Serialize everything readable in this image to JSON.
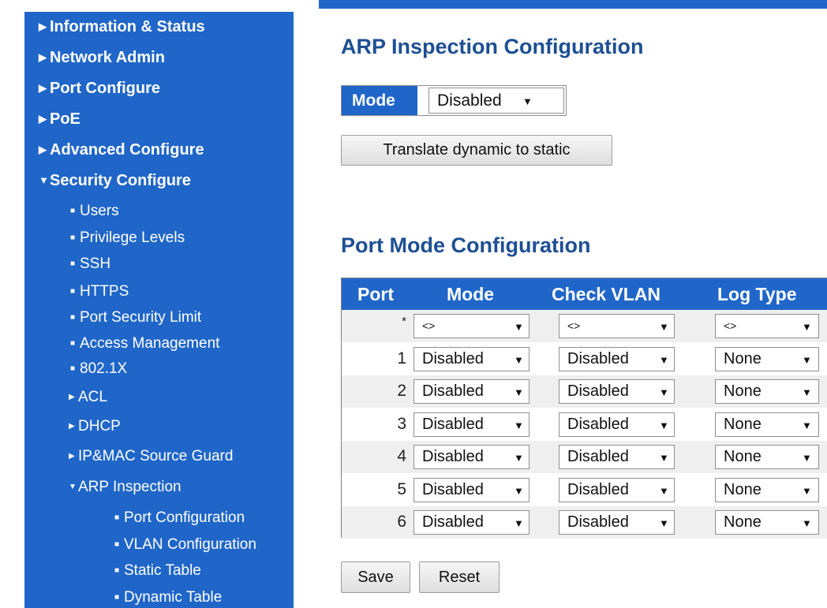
{
  "sidebar": {
    "top_items": [
      {
        "label": "Information & Status",
        "glyph": "▶"
      },
      {
        "label": "Network Admin",
        "glyph": "▶"
      },
      {
        "label": "Port Configure",
        "glyph": "▶"
      },
      {
        "label": "PoE",
        "glyph": "▶"
      },
      {
        "label": "Advanced Configure",
        "glyph": "▶"
      },
      {
        "label": "Security Configure",
        "glyph": "▼"
      }
    ],
    "security_items": [
      {
        "label": "Users",
        "glyph": "■"
      },
      {
        "label": "Privilege Levels",
        "glyph": "■"
      },
      {
        "label": "SSH",
        "glyph": "■"
      },
      {
        "label": "HTTPS",
        "glyph": "■"
      },
      {
        "label": "Port Security Limit",
        "glyph": "■"
      },
      {
        "label": "Access Management",
        "glyph": "■"
      },
      {
        "label": "802.1X",
        "glyph": "■"
      },
      {
        "label": "ACL",
        "glyph": "▶"
      },
      {
        "label": "DHCP",
        "glyph": "▶"
      },
      {
        "label": "IP&MAC Source Guard",
        "glyph": "▶"
      },
      {
        "label": "ARP Inspection",
        "glyph": "▼"
      }
    ],
    "arp_items": [
      {
        "label": "Port Configuration",
        "glyph": "■"
      },
      {
        "label": "VLAN Configuration",
        "glyph": "■"
      },
      {
        "label": "Static Table",
        "glyph": "■"
      },
      {
        "label": "Dynamic Table",
        "glyph": "■"
      }
    ]
  },
  "main": {
    "title": "ARP Inspection Configuration",
    "mode_label": "Mode",
    "mode_value": "Disabled",
    "translate_button": "Translate dynamic to static",
    "port_mode_title": "Port Mode Configuration",
    "table": {
      "headers": [
        "Port",
        "Mode",
        "Check VLAN",
        "Log Type"
      ],
      "wildcard_row": {
        "port": "*",
        "mode": "<>",
        "check_vlan": "<>",
        "log_type": "<>"
      },
      "rows": [
        {
          "port": "1",
          "mode": "Disabled",
          "check_vlan": "Disabled",
          "log_type": "None"
        },
        {
          "port": "2",
          "mode": "Disabled",
          "check_vlan": "Disabled",
          "log_type": "None"
        },
        {
          "port": "3",
          "mode": "Disabled",
          "check_vlan": "Disabled",
          "log_type": "None"
        },
        {
          "port": "4",
          "mode": "Disabled",
          "check_vlan": "Disabled",
          "log_type": "None"
        },
        {
          "port": "5",
          "mode": "Disabled",
          "check_vlan": "Disabled",
          "log_type": "None"
        },
        {
          "port": "6",
          "mode": "Disabled",
          "check_vlan": "Disabled",
          "log_type": "None"
        }
      ]
    },
    "save_button": "Save",
    "reset_button": "Reset",
    "dropdown_arrow": "▼"
  },
  "colors": {
    "accent": "#2066c9",
    "heading": "#1d4f93"
  }
}
